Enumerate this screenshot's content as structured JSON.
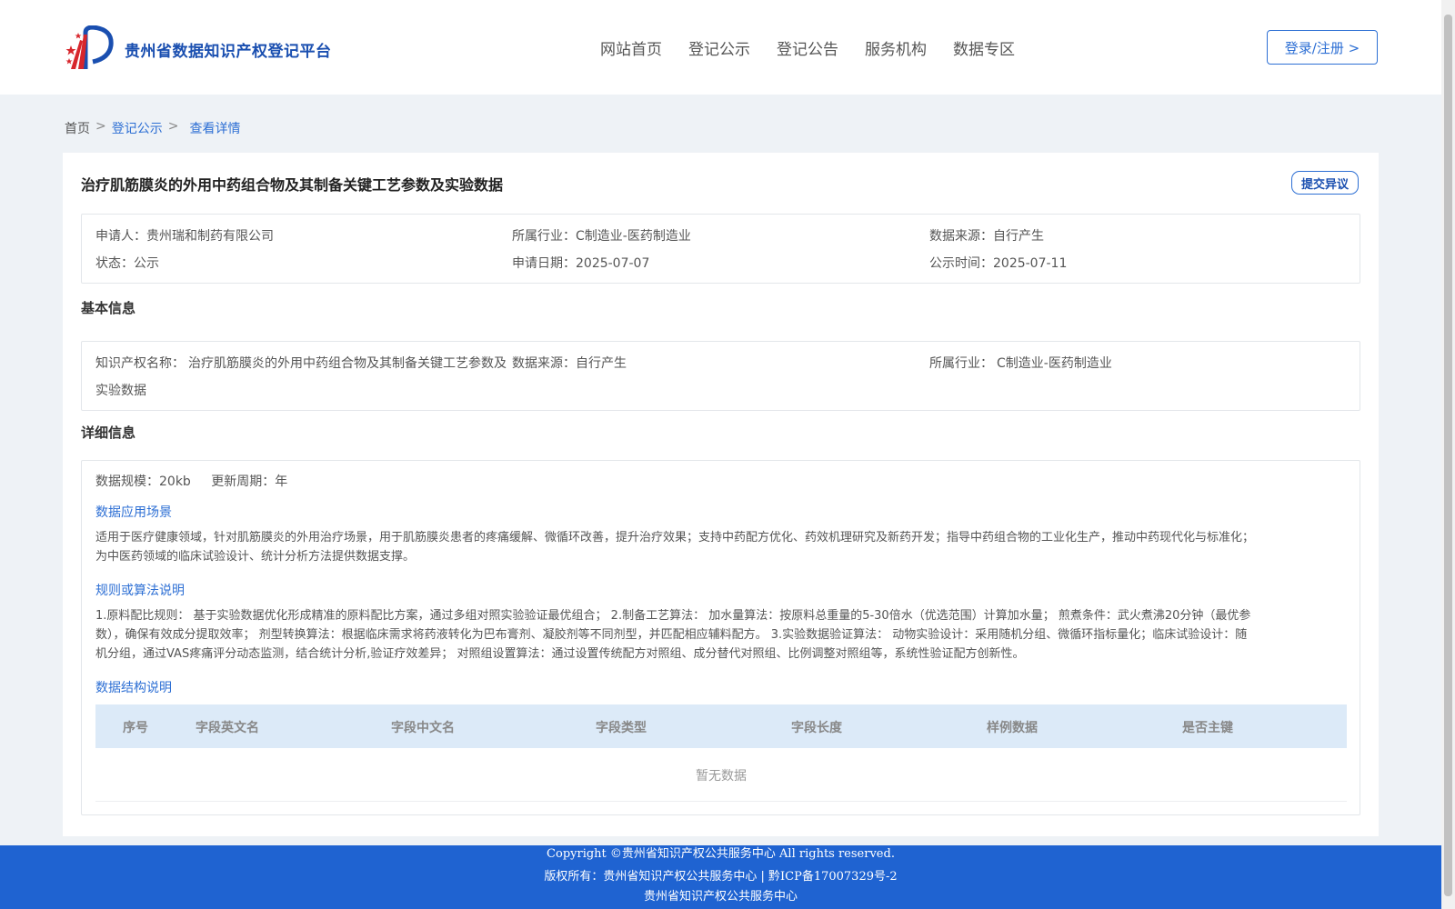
{
  "header": {
    "site_title": "贵州省数据知识产权登记平台",
    "nav": [
      "网站首页",
      "登记公示",
      "登记公告",
      "服务机构",
      "数据专区"
    ],
    "login_label": "登录/注册 >"
  },
  "breadcrumb": {
    "home": "首页",
    "sep": ">",
    "level1": "登记公示",
    "current": "查看详情"
  },
  "record": {
    "title": "治疗肌筋膜炎的外用中药组合物及其制备关键工艺参数及实验数据",
    "objection_label": "提交异议",
    "summary": {
      "applicant_label": "申请人：",
      "applicant": "贵州瑞和制药有限公司",
      "industry_label": "所属行业：",
      "industry": "C制造业-医药制造业",
      "source_label": "数据来源：",
      "source": "自行产生",
      "status_label": "状态：",
      "status": "公示",
      "apply_date_label": "申请日期：",
      "apply_date": "2025-07-07",
      "publish_date_label": "公示时间：",
      "publish_date": "2025-07-11"
    }
  },
  "basic": {
    "heading": "基本信息",
    "ip_name_label": "知识产权名称：",
    "ip_name_line1": "治疗肌筋膜炎的外用中药组合物及其制备关键工艺参数及",
    "ip_name_line2": "实验数据",
    "source_label": "数据来源：",
    "source": "自行产生",
    "industry_label": "所属行业：",
    "industry": "C制造业-医药制造业"
  },
  "detail": {
    "heading": "详细信息",
    "scale_label": "数据规模：",
    "scale": "20kb",
    "cycle_label": "更新周期：",
    "cycle": "年",
    "scenario_heading": "数据应用场景",
    "scenario_line1": "适用于医疗健康领域，针对肌筋膜炎的外用治疗场景，用于肌筋膜炎患者的疼痛缓解、微循环改善，提升治疗效果；支持中药配方优化、药效机理研究及新药开发；指导中药组合物的工业化生产，推动中药现代化与标准化；",
    "scenario_line2": "为中医药领域的临床试验设计、统计分析方法提供数据支撑。",
    "rules_heading": "规则或算法说明",
    "rules_line1": "1.原料配比规则： 基于实验数据优化形成精准的原料配比方案，通过多组对照实验验证最优组合； 2.制备工艺算法： 加水量算法：按原料总重量的5-30倍水（优选范围）计算加水量； 煎煮条件：武火煮沸20分钟（最优参",
    "rules_line2": "数），确保有效成分提取效率； 剂型转换算法：根据临床需求将药液转化为巴布膏剂、凝胶剂等不同剂型，并匹配相应辅料配方。 3.实验数据验证算法： 动物实验设计：采用随机分组、微循环指标量化；临床试验设计：随",
    "rules_line3": "机分组，通过VAS疼痛评分动态监测，结合统计分析,验证疗效差异； 对照组设置算法：通过设置传统配方对照组、成分替代对照组、比例调整对照组等，系统性验证配方创新性。",
    "structure_heading": "数据结构说明",
    "table_headers": [
      "序号",
      "字段英文名",
      "字段中文名",
      "字段类型",
      "字段长度",
      "样例数据",
      "是否主键"
    ],
    "empty_text": "暂无数据"
  },
  "footer": {
    "line1": "Copyright ©贵州省知识产权公共服务中心 All rights reserved.",
    "line2": "版权所有：贵州省知识产权公共服务中心 | 黔ICP备17007329号-2",
    "line3": "贵州省知识产权公共服务中心"
  },
  "colors": {
    "brand_blue": "#1f63d1",
    "link_blue": "#2d6fd4",
    "table_header_bg": "#dceaf8"
  }
}
